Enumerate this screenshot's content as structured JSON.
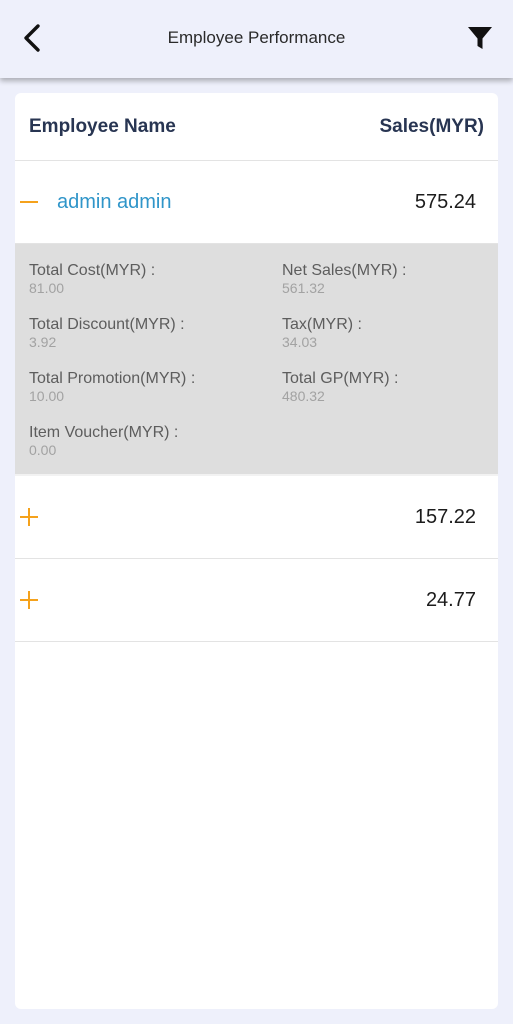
{
  "appbar": {
    "title": "Employee Performance"
  },
  "table": {
    "col_name": "Employee Name",
    "col_sales": "Sales(MYR)",
    "rows": [
      {
        "name": "admin admin",
        "sales": "575.24",
        "expanded": true,
        "details": {
          "total_cost_label": "Total Cost(MYR) :",
          "total_cost": "81.00",
          "net_sales_label": "Net Sales(MYR) :",
          "net_sales": "561.32",
          "total_discount_label": "Total Discount(MYR) :",
          "total_discount": "3.92",
          "tax_label": "Tax(MYR) :",
          "tax": "34.03",
          "total_promotion_label": "Total Promotion(MYR) :",
          "total_promotion": "10.00",
          "total_gp_label": "Total GP(MYR) :",
          "total_gp": "480.32",
          "item_voucher_label": "Item Voucher(MYR) :",
          "item_voucher": "0.00"
        }
      },
      {
        "name": "",
        "sales": "157.22",
        "expanded": false
      },
      {
        "name": "",
        "sales": "24.77",
        "expanded": false
      }
    ]
  },
  "colors": {
    "accent": "#f5a21c",
    "name_link": "#2f95c9",
    "header_text": "#283552"
  }
}
